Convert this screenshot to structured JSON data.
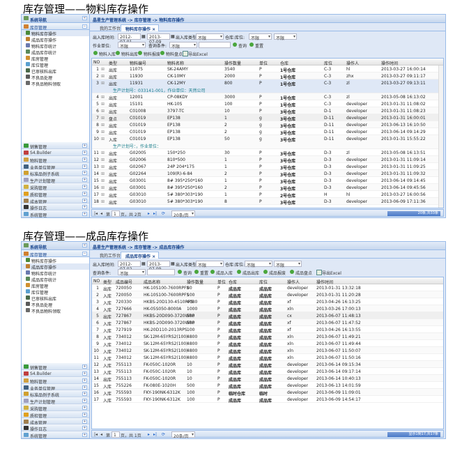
{
  "screens": [
    {
      "heading": "库存管理——物料库存操作",
      "sidebar": {
        "title": "系统导航",
        "group": "库存管理",
        "items": [
          "物料库存操作",
          "成品库存操作",
          "物料库存统计",
          "成品库存统计",
          "库房管理",
          "库位管理",
          "已审核料出库",
          "不良品处理",
          "不良品物料领取"
        ],
        "selected": 0,
        "accordions": [
          "销售管理",
          "S4.Builder",
          "物料管理",
          "业务单位管理",
          "标准品例子系统",
          "生产计划管理",
          "采购管理",
          "质检管理",
          "成本管理",
          "操作日志",
          "系统管理"
        ]
      },
      "breadcrumb": "晶星生产管理系统 -> 库存管理 -> 物料库存操作",
      "tabs": [
        "我的工作台",
        "物料库存操作 ×"
      ],
      "filters": {
        "date_label": "出入库时间:",
        "date_from": "2012-07-01",
        "date_to": "2013-07-09",
        "type_label": "出入库类型:",
        "type_value": "不限",
        "loc_label": "仓库:库位:",
        "wh_value": "不限",
        "loc_value": "不限",
        "unit_label": "作业单位:",
        "unit_value": "不限",
        "cond_label": "查询条件:",
        "cond_value": "不限",
        "search_value": "",
        "query": "查询",
        "reset": "重置"
      },
      "toolbar": [
        "物料入库",
        "物料出库",
        "物料报废",
        "物料盘点",
        "导出Excel"
      ],
      "columns": [
        "NO",
        "类型",
        "物料编号",
        "物料名称",
        "操作数量",
        "单位",
        "仓库",
        "库位",
        "操作人",
        "操作时间"
      ],
      "rows": [
        [
          "1",
          "出库",
          "11075",
          "SK-24AMY",
          "3540",
          "P",
          "1号仓库",
          "C-3",
          "hl",
          "2013-03-27 16:00:14"
        ],
        [
          "2",
          "出库",
          "11930",
          "CK-10MY",
          "2000",
          "P",
          "1号仓库",
          "C-3",
          "zhx",
          "2013-03-27 09:11:17"
        ],
        [
          "3",
          "出库",
          "11931",
          "CK-12MY",
          "800",
          "P",
          "1号仓库",
          "C-3",
          "zl",
          "2013-03-27 09:13:11",
          "生产计划号：033141-001，作业单位：天然公司"
        ],
        [
          "4",
          "出库",
          "12001",
          "CP-08KDY",
          "3000",
          "P",
          "1号仓库",
          "C-3",
          "zl",
          "2013-05-08 16:13:02"
        ],
        [
          "5",
          "出库",
          "15101",
          "HK-10S",
          "100",
          "P",
          "1号仓库",
          "C-3",
          "developer",
          "2013-01-31 11:08:02"
        ],
        [
          "6",
          "出库",
          "C01008",
          "3797-TC",
          "10",
          "P",
          "3号仓库",
          "D-1",
          "developer",
          "2013-01-31 11:08:23"
        ],
        [
          "7",
          "盘点",
          "C01019",
          "EP138",
          "1",
          "g",
          "3号仓库",
          "D-11",
          "developer",
          "2013-01-31 16:00:01"
        ],
        [
          "8",
          "出库",
          "C01019",
          "EP138",
          "2",
          "g",
          "3号仓库",
          "D-11",
          "developer",
          "2013-06-13 16:10:50"
        ],
        [
          "9",
          "出库",
          "C01019",
          "EP138",
          "2",
          "g",
          "3号仓库",
          "D-11",
          "developer",
          "2013-06-14 09:14:29"
        ],
        [
          "10",
          "入库",
          "C01019",
          "EP138",
          "50",
          "g",
          "3号仓库",
          "D-11",
          "developer",
          "2013-01-31 15:55:22",
          "生产计划号：，作业单位："
        ],
        [
          "11",
          "出库",
          "G02005",
          "150*250",
          "30",
          "P",
          "3号仓库",
          "D-3",
          "zl",
          "2013-05-08 16:13:51"
        ],
        [
          "12",
          "出库",
          "G02006",
          "810*500",
          "1",
          "P",
          "3号仓库",
          "D-3",
          "developer",
          "2013-01-31 11:09:14"
        ],
        [
          "13",
          "出库",
          "G02067",
          "24P 204*175",
          "1",
          "P",
          "3号仓库",
          "D-3",
          "developer",
          "2013-01-31 11:09:25"
        ],
        [
          "14",
          "出库",
          "G02264",
          "109(R)-6-84",
          "2",
          "P",
          "3号仓库",
          "D-3",
          "developer",
          "2013-01-31 11:09:32"
        ],
        [
          "15",
          "出库",
          "G03001",
          "8# 395*250*160",
          "1",
          "P",
          "3号仓库",
          "D-3",
          "developer",
          "2013-06-14 09:14:45"
        ],
        [
          "16",
          "出库",
          "G03001",
          "8# 395*250*160",
          "2",
          "P",
          "3号仓库",
          "D-3",
          "developer",
          "2013-06-14 09:45:56"
        ],
        [
          "17",
          "出库",
          "G03010",
          "5# 380*303*190",
          "1",
          "P",
          "2号仓库",
          "H",
          "hl",
          "2013-03-27 16:00:56"
        ],
        [
          "18",
          "出库",
          "G03010",
          "5# 380*303*190",
          "8",
          "P",
          "3号仓库",
          "D-3",
          "developer",
          "2013-06-09 17:11:36"
        ]
      ],
      "pager": {
        "page_prefix": "第",
        "page": "1",
        "page_suffix": "页，共 2页",
        "page_size": "20条/页",
        "status": "20条,共33条"
      }
    },
    {
      "heading": "库存管理——成品库存操作",
      "sidebar": {
        "title": "系统导航",
        "group": "库存管理",
        "items": [
          "物料库存操作",
          "成品库存操作",
          "物料库存统计",
          "成品库存统计",
          "库房管理",
          "库位管理",
          "已审核料出库",
          "不良品处理",
          "不良品物料领取"
        ],
        "selected": 1,
        "accordions": [
          "销售管理",
          "S4.Builder",
          "物料管理",
          "业务单位管理",
          "标准品例子系统",
          "生产计划管理",
          "采购管理",
          "质检管理",
          "成本管理",
          "操作日志",
          "系统管理"
        ]
      },
      "breadcrumb": "晶星生产管理系统 -> 库存管理 -> 成品库存操作",
      "tabs": [
        "我的工作台",
        "成品库存操作 ×"
      ],
      "filters": {
        "date_label": "出入库时间:",
        "date_from": "2012-07-02",
        "date_to": "2013-07-09",
        "type_label": "出入库类型:",
        "type_value": "不限",
        "loc_label": "仓库:库位:",
        "wh_value": "不限",
        "loc_value": "不限",
        "cond_label": "查询条件:",
        "cond_value": "不限",
        "search_value": "",
        "query": "查询",
        "reset": "重置"
      },
      "toolbar": [
        "成品入库",
        "成品出库",
        "成品报废",
        "成品盘点",
        "导出Excel"
      ],
      "columns": [
        "NO",
        "类型",
        "成品编号",
        "成品名称",
        "操作数量",
        "单位",
        "仓库",
        "库位",
        "操作人",
        "操作时间"
      ],
      "rows": [
        [
          "1",
          "出库",
          "720050",
          "HK-10S100-7600RPFS",
          "80",
          "P",
          "成品库",
          "成品库",
          "developer",
          "2013-01-31 13:32:18"
        ],
        [
          "2",
          "入库",
          "720050",
          "HK-10S100-7600RPFS",
          "100",
          "P",
          "成品库",
          "成品库",
          "developer",
          "2013-01-31 11:20:28"
        ],
        [
          "3",
          "入库",
          "720330",
          "HKBS-20D130-4510RPS",
          "4080",
          "P",
          "成品库",
          "成品库",
          "xf",
          "2013-04-26 16:13:25"
        ],
        [
          "4",
          "入库",
          "727666",
          "HK-05S050-8000A",
          "1000",
          "P",
          "成品库",
          "成品库",
          "xln",
          "2013-03-26 17:00:13"
        ],
        [
          "5",
          "出库",
          "727867",
          "HKBS-20D090-3720WRP",
          "500",
          "P",
          "成品库",
          "成品库",
          "cx",
          "2013-06-07 11:48:13"
        ],
        [
          "6",
          "入库",
          "727867",
          "HKBS-20D090-3720WRP",
          "500",
          "P",
          "成品库",
          "成品库",
          "xf",
          "2013-06-07 11:47:52"
        ],
        [
          "7",
          "入库",
          "727919",
          "HK-20D110-2013RPS",
          "100",
          "P",
          "成品库",
          "成品库",
          "xf",
          "2013-04-26 16:13:55"
        ],
        [
          "8",
          "入库",
          "734012",
          "SK-12M-65YRS2(100)",
          "4800",
          "P",
          "成品库",
          "成品库",
          "xln",
          "2013-06-07 11:49:21"
        ],
        [
          "9",
          "入库",
          "734012",
          "SK-12M-65YRS2(100)",
          "4800",
          "P",
          "成品库",
          "成品库",
          "xln",
          "2013-06-07 11:49:44"
        ],
        [
          "10",
          "入库",
          "734012",
          "SK-12M-65YRS2(100)",
          "4800",
          "P",
          "成品库",
          "成品库",
          "xln",
          "2013-06-07 11:50:07"
        ],
        [
          "11",
          "入库",
          "734012",
          "SK-12M-65YRS2(100)",
          "4800",
          "P",
          "成品库",
          "成品库",
          "xln",
          "2013-06-07 11:50:16"
        ],
        [
          "12",
          "入库",
          "755113",
          "FK-050C-1020R",
          "10",
          "P",
          "成品库",
          "成品库",
          "developer",
          "2013-06-14 09:15:34"
        ],
        [
          "13",
          "入库",
          "755113",
          "FK-050C-1020R",
          "10",
          "P",
          "成品库",
          "成品库",
          "developer",
          "2013-06-14 09:17:14"
        ],
        [
          "14",
          "出库",
          "755113",
          "FK-050C-1020R",
          "10",
          "P",
          "成品库",
          "成品库",
          "developer",
          "2013-06-14 10:40:13"
        ],
        [
          "15",
          "入库",
          "755226",
          "FK-080E-1020H",
          "500",
          "P",
          "成品库",
          "成品库",
          "developer",
          "2013-06-13 14:01:59"
        ],
        [
          "16",
          "入库",
          "755593",
          "FKY-190NK-6312K",
          "100",
          "P",
          "临时仓库",
          "临时",
          "developer",
          "2013-06-09 11:09:01"
        ],
        [
          "17",
          "入库",
          "755593",
          "FKY-190NK-6312K",
          "100",
          "P",
          "成品库",
          "成品库",
          "developer",
          "2013-06-09 14:54:17"
        ]
      ],
      "pager": {
        "page_prefix": "第",
        "page": "1",
        "page_suffix": "页，共 1页",
        "page_size": "20条/页",
        "status": "显示1到17,共17条"
      }
    }
  ],
  "colors": {
    "border": "#99bbe8",
    "panel_bg": "#dfe8f6",
    "header_text": "#15428b",
    "detail_text": "#1a7e8a",
    "add_icon": "#4aa63c"
  }
}
